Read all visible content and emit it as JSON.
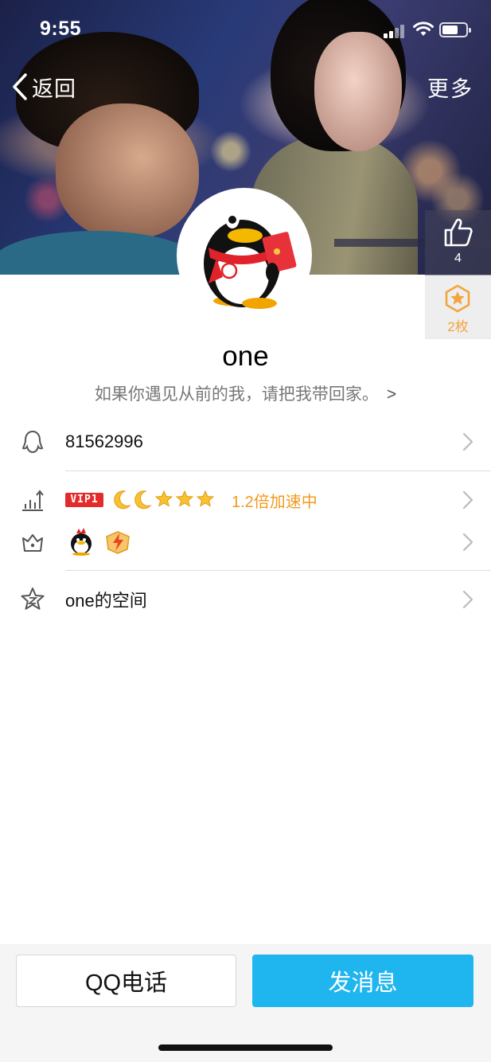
{
  "status_bar": {
    "time": "9:55"
  },
  "nav": {
    "back_label": "返回",
    "more_label": "更多"
  },
  "side": {
    "like_count": "4",
    "medal_count": "2枚"
  },
  "profile": {
    "nickname": "one",
    "signature": "如果你遇见从前的我，请把我带回家。",
    "signature_arrow": ">"
  },
  "rows": {
    "qq_number": "81562996",
    "vip_badge": "VIP1",
    "speed_text": "1.2倍加速中",
    "space_label": "one的空间"
  },
  "buttons": {
    "call": "QQ电话",
    "message": "发消息"
  },
  "colors": {
    "accent": "#1fb5ef",
    "vip_red": "#e42a2a",
    "gold": "#f29a1d"
  }
}
